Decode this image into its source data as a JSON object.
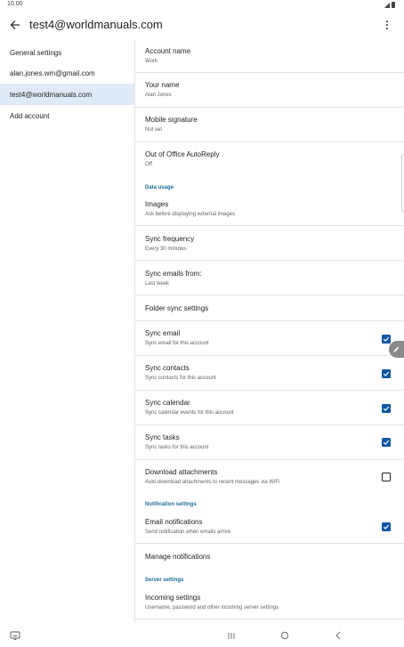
{
  "status_bar": {
    "time": "10.00"
  },
  "app_bar": {
    "title": "test4@worldmanuals.com"
  },
  "sidebar": {
    "items": [
      {
        "label": "General settings"
      },
      {
        "label": "alan.jones.wm@gmail.com"
      },
      {
        "label": "test4@worldmanuals.com",
        "selected": true
      },
      {
        "label": "Add account"
      }
    ]
  },
  "settings": {
    "account_name": {
      "title": "Account name",
      "value": "Work"
    },
    "your_name": {
      "title": "Your name",
      "value": "Alan Jones"
    },
    "mobile_signature": {
      "title": "Mobile signature",
      "value": "Not set"
    },
    "out_of_office": {
      "title": "Out of Office AutoReply",
      "value": "Off"
    },
    "data_usage_header": "Data usage",
    "images": {
      "title": "Images",
      "value": "Ask before displaying external images"
    },
    "sync_frequency": {
      "title": "Sync frequency",
      "value": "Every 30 minutes"
    },
    "sync_emails_from": {
      "title": "Sync emails from:",
      "value": "Last week"
    },
    "folder_sync": {
      "title": "Folder sync settings"
    },
    "sync_email": {
      "title": "Sync email",
      "value": "Sync email for this account",
      "checked": true
    },
    "sync_contacts": {
      "title": "Sync contacts",
      "value": "Sync contacts for this account",
      "checked": true
    },
    "sync_calendar": {
      "title": "Sync calendar",
      "value": "Sync calendar events for this account",
      "checked": true
    },
    "sync_tasks": {
      "title": "Sync tasks",
      "value": "Sync tasks for this account",
      "checked": true
    },
    "download_attachments": {
      "title": "Download attachments",
      "value": "Auto-download attachments to recent messages via WiFi",
      "checked": false
    },
    "notification_header": "Notification settings",
    "email_notifications": {
      "title": "Email notifications",
      "value": "Send notification when emails arrive",
      "checked": true
    },
    "manage_notifications": {
      "title": "Manage notifications"
    },
    "server_header": "Server settings",
    "incoming_settings": {
      "title": "Incoming settings",
      "value": "Username, password and other incoming server settings"
    }
  },
  "colors": {
    "accent": "#0b57a8",
    "section_header": "#1a6e9a",
    "selected_bg": "#dfe9f8"
  },
  "icons": [
    "back-arrow-icon",
    "more-vert-icon",
    "checkmark-icon",
    "pencil-icon",
    "recents-icon",
    "home-icon",
    "back-nav-icon",
    "keyboard-icon"
  ]
}
